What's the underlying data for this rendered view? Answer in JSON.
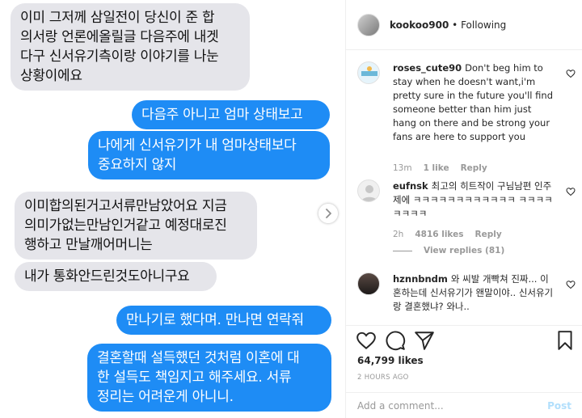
{
  "messages": [
    {
      "side": "in",
      "text": "이미 그저께 삼일전이 당신이 준 합\n의서랑 언론에올릴글 다음주에 내겟\n다구 신서유기측이랑 이야기를 나눈\n상황이에요"
    },
    {
      "side": "out",
      "text": "다음주 아니고 엄마 상태보고"
    },
    {
      "side": "out",
      "text": "나에게 신서유기가 내 엄마상태보다\n중요하지 않지"
    },
    {
      "side": "in",
      "text": "이미합의된거고서류만남았어요 지금\n의미가없는만남인거같고 예정대로진\n행하고 만날깨어머니는"
    },
    {
      "side": "in",
      "text": "내가 통화안드린것도아니구요"
    },
    {
      "side": "out",
      "text": "만나기로 했다며. 만나면 연락줘"
    },
    {
      "side": "out",
      "text": "결혼할때 설득했던 것처럼 이혼에 대\n한 설득도 책임지고 해주세요. 서류\n정리는 어려운게 아니니."
    }
  ],
  "post": {
    "username": "kookoo900",
    "dot": "•",
    "follow_status": "Following"
  },
  "comments": [
    {
      "username": "roses_cute90",
      "text": "Don't beg him to stay when he doesn't want,i'm pretty sure in the future you'll find someone better than him just hang on there and be strong your fans are here to support you",
      "time": "13m",
      "likes": "1 like",
      "reply": "Reply"
    },
    {
      "username": "eufnsk",
      "text": "최고의 히트작이 구님남편 인주제에 ㅋㅋㅋㅋㅋㅋㅋㅋㅋㅋㅋㅋ ㅋㅋㅋㅋㅋㅋㅋㅋ",
      "time": "2h",
      "likes": "4816 likes",
      "reply": "Reply",
      "view_replies": "View replies (81)"
    },
    {
      "username": "hznnbndm",
      "text": "와 씨발 개빡쳐 진짜... 이혼하는데 신서유기가 왠말이야.. 신서유기랑 결혼했냐? 와나..",
      "time": "",
      "likes": "",
      "reply": ""
    }
  ],
  "likes_count": "64,799 likes",
  "timestamp": "2 HOURS AGO",
  "add_comment": {
    "placeholder": "Add a comment...",
    "post_label": "Post"
  },
  "colors": {
    "incoming_bubble": "#e5e5ea",
    "outgoing_bubble": "#1e8cf5",
    "post_button": "#b2dffc"
  },
  "icons": [
    "chevron-right-icon",
    "heart-icon",
    "comment-icon",
    "share-icon",
    "bookmark-icon"
  ]
}
